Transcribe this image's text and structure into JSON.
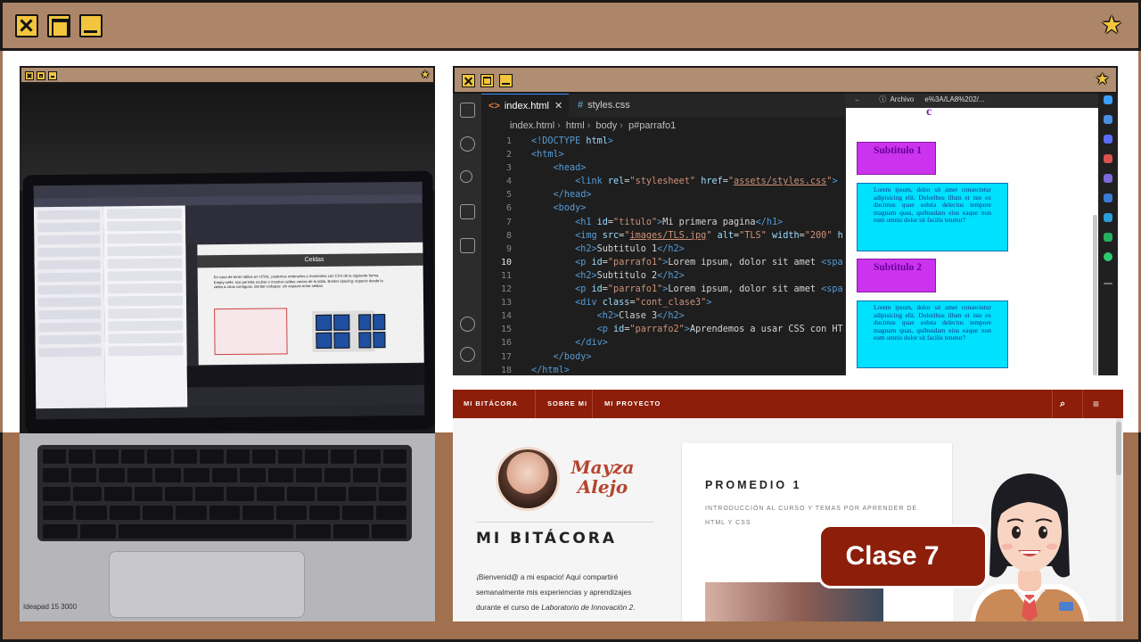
{
  "frame": {
    "icons": [
      "close-icon",
      "maximize-icon",
      "minimize-icon",
      "star-icon"
    ]
  },
  "editor": {
    "tabs": [
      {
        "label": "index.html",
        "close": "✕"
      },
      {
        "label": "styles.css"
      }
    ],
    "breadcrumbs": [
      "index.html",
      "html",
      "body",
      "p#parrafo1"
    ],
    "current_line": "10",
    "lines": [
      {
        "n": "1",
        "html": "<span class='tg'>&lt;!DOCTYPE</span> <span class='an'>html</span><span class='tg'>&gt;</span>"
      },
      {
        "n": "2",
        "html": "<span class='tg'>&lt;html&gt;</span>"
      },
      {
        "n": "3",
        "html": "    <span class='tg'>&lt;head&gt;</span>"
      },
      {
        "n": "4",
        "html": "        <span class='tg'>&lt;link</span> <span class='an'>rel</span>=<span class='av'>\"stylesheet\"</span> <span class='an'>href</span>=<span class='av'>\"<span class='link-u'>assets/styles.css</span>\"</span><span class='tg'>&gt;</span>"
      },
      {
        "n": "5",
        "html": "    <span class='tg'>&lt;/head&gt;</span>"
      },
      {
        "n": "6",
        "html": "    <span class='tg'>&lt;body&gt;</span>"
      },
      {
        "n": "7",
        "html": "        <span class='tg'>&lt;h1</span> <span class='an'>id</span>=<span class='av'>\"titulo\"</span><span class='tg'>&gt;</span>Mi primera pagina<span class='tg'>&lt;/h1&gt;</span>"
      },
      {
        "n": "8",
        "html": "        <span class='tg'>&lt;img</span> <span class='an'>src</span>=<span class='av'>\"<span class='link-u'>images/TLS.jpg</span>\"</span> <span class='an'>alt</span>=<span class='av'>\"TLS\"</span> <span class='an'>width</span>=<span class='av'>\"200\"</span> <span class='an'>h</span>"
      },
      {
        "n": "9",
        "html": "        <span class='tg'>&lt;h2&gt;</span>Subtitulo 1<span class='tg'>&lt;/h2&gt;</span>"
      },
      {
        "n": "10",
        "html": "        <span class='tg'>&lt;p</span> <span class='an'>id</span>=<span class='av'>\"parrafo1\"</span><span class='tg'>&gt;</span>Lorem ipsum, dolor sit amet <span class='tg'>&lt;spa</span>"
      },
      {
        "n": "11",
        "html": "        <span class='tg'>&lt;h2&gt;</span>Subtitulo 2<span class='tg'>&lt;/h2&gt;</span>"
      },
      {
        "n": "12",
        "html": "        <span class='tg'>&lt;p</span> <span class='an'>id</span>=<span class='av'>\"parrafo1\"</span><span class='tg'>&gt;</span>Lorem ipsum, dolor sit amet <span class='tg'>&lt;spa</span>"
      },
      {
        "n": "13",
        "html": "        <span class='tg'>&lt;div</span> <span class='an'>class</span>=<span class='av'>\"cont_clase3\"</span><span class='tg'>&gt;</span>"
      },
      {
        "n": "14",
        "html": "            <span class='tg'>&lt;h2&gt;</span>Clase 3<span class='tg'>&lt;/h2&gt;</span>"
      },
      {
        "n": "15",
        "html": "            <span class='tg'>&lt;p</span> <span class='an'>id</span>=<span class='av'>\"parrafo2\"</span><span class='tg'>&gt;</span>Aprendemos a usar CSS con HT"
      },
      {
        "n": "16",
        "html": "        <span class='tg'>&lt;/div&gt;</span>"
      },
      {
        "n": "17",
        "html": "    <span class='tg'>&lt;/body&gt;</span>"
      },
      {
        "n": "18",
        "html": "<span class='tg'>&lt;/html&gt;</span>"
      }
    ]
  },
  "browser": {
    "toolbar_text": "Archivo",
    "address_text": "e%3A/LA8%202/...",
    "big_char": "c",
    "subtitles": [
      "Subtitulo 1",
      "Subtitulo 2"
    ],
    "paragraph": "Lorem ipsum, dolor sit amet consectetur adipisicing elit. Doloribus illum et iste ex ducimus quae soluta delectus tempore magnam quas, quibusdam eius eaque non eum omnis dolor sit facilis tenetur?"
  },
  "laptop_screen": {
    "slide_title": "Celdas",
    "slide_text": "En caso de tener tablas en HTML, podemos ordenarlas y mostrarlas con CSS de la siguiente forma. Empty-cells: nos permite ocultar o mostrar celdas vacías de la tabla. Border-spacing: espacio desde la celda a otras contiguas. Border-collapse: sin espacio entre celdas.",
    "brand": "Ideapad 15 3000"
  },
  "blog": {
    "nav": {
      "brand": "MI BITÁCORA",
      "items": [
        "SOBRE MI",
        "MI PROYECTO"
      ]
    },
    "logo_line1": "Mayza",
    "logo_line2": "Alejo",
    "title": "MI BITÁCORA",
    "intro_html": "¡Bienvenid@ a mi espacio! Aquí compartiré semanalmente mis experiencias y aprendizajes durante el curso de <i>Laboratorio de Innovación 2</i>.",
    "card_title": "PROMEDIO 1",
    "card_subtitle": "INTRODUCCIÓN AL CURSO Y TEMAS POR APRENDER DE HTML Y CSS"
  },
  "badge": {
    "label": "Clase 7"
  },
  "colors": {
    "frame": "#ad8568",
    "accent": "#f2c53d",
    "blog_nav": "#8c1e0a",
    "subtitle_box": "#cc33ee",
    "paragraph_box": "#00e0ff"
  }
}
